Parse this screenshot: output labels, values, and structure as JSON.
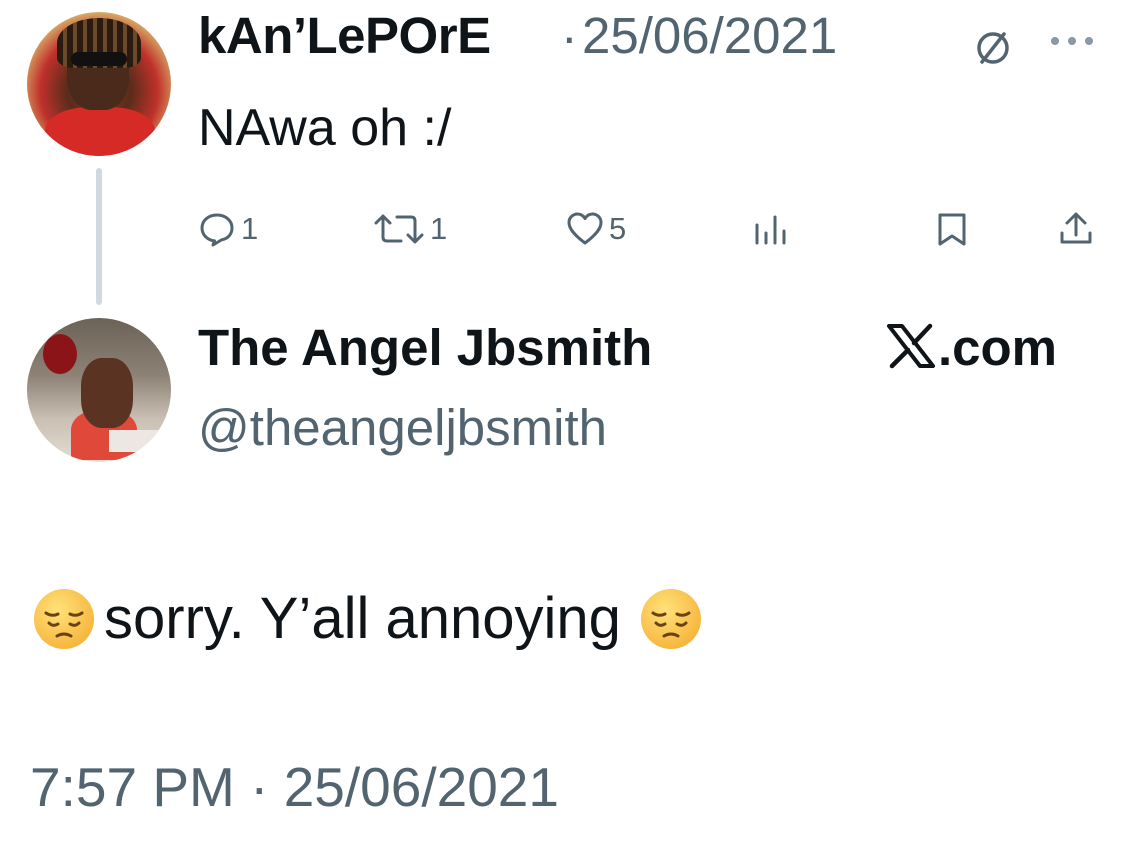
{
  "tweet": {
    "author_name": "kAn’LePOrE",
    "separator": "·",
    "date": "25/06/2021",
    "text": "NAwa oh :/",
    "icons": {
      "mute": "circle-slash-icon",
      "more": "more-dots-icon"
    },
    "actions": {
      "reply_count": "1",
      "retweet_count": "1",
      "like_count": "5"
    }
  },
  "quoted": {
    "author_name": "The Angel Jbsmith",
    "handle": "@theangeljbsmith",
    "source": ".com",
    "text": "sorry. Y’all annoying",
    "emoji": "pensive-face",
    "timestamp": "7:57 PM · 25/06/2021"
  },
  "colors": {
    "text": "#0f1419",
    "muted": "#536471",
    "thread_line": "#cfd9de",
    "background": "#ffffff"
  }
}
